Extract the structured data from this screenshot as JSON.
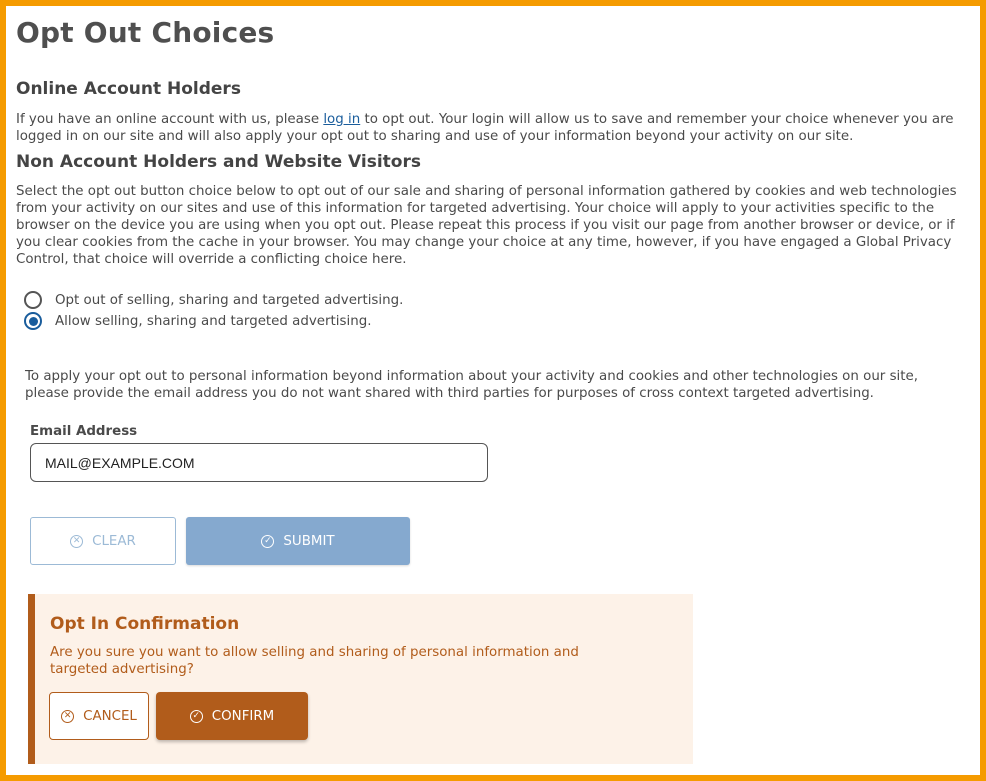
{
  "page": {
    "title": "Opt Out Choices"
  },
  "account_holders": {
    "heading": "Online Account Holders",
    "text_before_link": "If you have an online account with us, please ",
    "link_text": "log in",
    "text_after_link": " to opt out. Your login will allow us to save and remember your choice whenever you are logged in on our site and will also apply your opt out to sharing and use of your information beyond your activity on our site."
  },
  "non_account": {
    "heading": "Non Account Holders and Website Visitors",
    "text": "Select the opt out button choice below to opt out of our sale and sharing of personal information gathered by cookies and web technologies from your activity on our sites and use of this information for targeted advertising. Your choice will apply to your activities specific to the browser on the device you are using when you opt out. Please repeat this process if you visit our page from another browser or device, or if you clear cookies from the cache in your browser. You may change your choice at any time, however, if you have engaged a Global Privacy Control, that choice will override a conflicting choice here."
  },
  "options": [
    {
      "label": "Opt out of selling, sharing and targeted advertising.",
      "selected": false
    },
    {
      "label": "Allow selling, sharing and targeted advertising.",
      "selected": true
    }
  ],
  "email_section": {
    "intro": "To apply your opt out to personal information beyond information about your activity and cookies and other technologies on our site, please provide the email address you do not want shared with third parties for purposes of cross context targeted advertising.",
    "label": "Email Address",
    "value": "MAIL@EXAMPLE.COM"
  },
  "actions": {
    "clear_label": "CLEAR",
    "clear_icon": "x-circle-icon",
    "submit_label": "SUBMIT",
    "submit_icon": "check-circle-icon"
  },
  "confirmation": {
    "title": "Opt In Confirmation",
    "text": "Are you sure you want to allow selling and sharing of personal information and targeted advertising?",
    "cancel_label": "CANCEL",
    "confirm_label": "CONFIRM"
  },
  "colors": {
    "frame_border": "#f59b00",
    "link": "#1a5d9c",
    "submit_bg": "#85a9cf",
    "confirm_accent": "#b15c1b",
    "confirm_bg": "#fdf2e8"
  }
}
